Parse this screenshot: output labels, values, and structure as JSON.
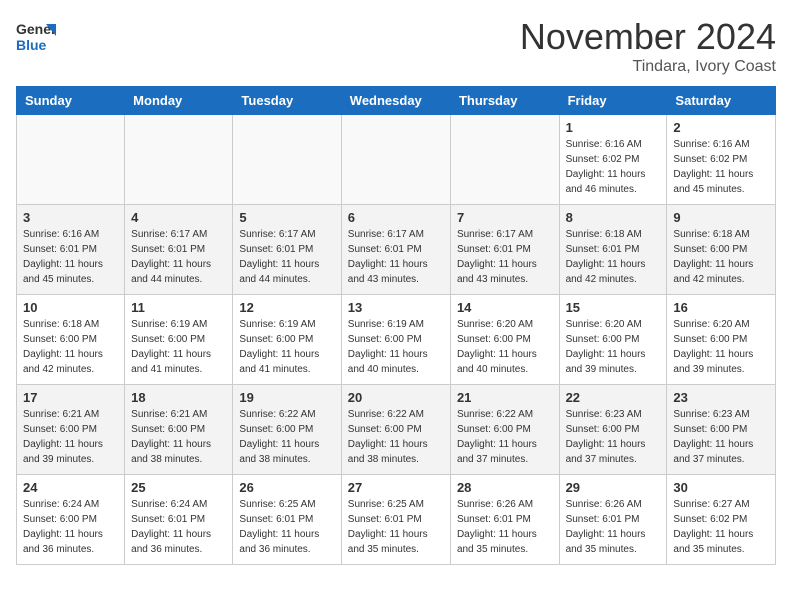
{
  "header": {
    "logo": {
      "text1": "General",
      "text2": "Blue"
    },
    "title": "November 2024",
    "location": "Tindara, Ivory Coast"
  },
  "calendar": {
    "days": [
      "Sunday",
      "Monday",
      "Tuesday",
      "Wednesday",
      "Thursday",
      "Friday",
      "Saturday"
    ],
    "weeks": [
      [
        {
          "day": "",
          "empty": true
        },
        {
          "day": "",
          "empty": true
        },
        {
          "day": "",
          "empty": true
        },
        {
          "day": "",
          "empty": true
        },
        {
          "day": "",
          "empty": true
        },
        {
          "day": "1",
          "sunrise": "6:16 AM",
          "sunset": "6:02 PM",
          "daylight": "11 hours and 46 minutes."
        },
        {
          "day": "2",
          "sunrise": "6:16 AM",
          "sunset": "6:02 PM",
          "daylight": "11 hours and 45 minutes."
        }
      ],
      [
        {
          "day": "3",
          "sunrise": "6:16 AM",
          "sunset": "6:01 PM",
          "daylight": "11 hours and 45 minutes."
        },
        {
          "day": "4",
          "sunrise": "6:17 AM",
          "sunset": "6:01 PM",
          "daylight": "11 hours and 44 minutes."
        },
        {
          "day": "5",
          "sunrise": "6:17 AM",
          "sunset": "6:01 PM",
          "daylight": "11 hours and 44 minutes."
        },
        {
          "day": "6",
          "sunrise": "6:17 AM",
          "sunset": "6:01 PM",
          "daylight": "11 hours and 43 minutes."
        },
        {
          "day": "7",
          "sunrise": "6:17 AM",
          "sunset": "6:01 PM",
          "daylight": "11 hours and 43 minutes."
        },
        {
          "day": "8",
          "sunrise": "6:18 AM",
          "sunset": "6:01 PM",
          "daylight": "11 hours and 42 minutes."
        },
        {
          "day": "9",
          "sunrise": "6:18 AM",
          "sunset": "6:00 PM",
          "daylight": "11 hours and 42 minutes."
        }
      ],
      [
        {
          "day": "10",
          "sunrise": "6:18 AM",
          "sunset": "6:00 PM",
          "daylight": "11 hours and 42 minutes."
        },
        {
          "day": "11",
          "sunrise": "6:19 AM",
          "sunset": "6:00 PM",
          "daylight": "11 hours and 41 minutes."
        },
        {
          "day": "12",
          "sunrise": "6:19 AM",
          "sunset": "6:00 PM",
          "daylight": "11 hours and 41 minutes."
        },
        {
          "day": "13",
          "sunrise": "6:19 AM",
          "sunset": "6:00 PM",
          "daylight": "11 hours and 40 minutes."
        },
        {
          "day": "14",
          "sunrise": "6:20 AM",
          "sunset": "6:00 PM",
          "daylight": "11 hours and 40 minutes."
        },
        {
          "day": "15",
          "sunrise": "6:20 AM",
          "sunset": "6:00 PM",
          "daylight": "11 hours and 39 minutes."
        },
        {
          "day": "16",
          "sunrise": "6:20 AM",
          "sunset": "6:00 PM",
          "daylight": "11 hours and 39 minutes."
        }
      ],
      [
        {
          "day": "17",
          "sunrise": "6:21 AM",
          "sunset": "6:00 PM",
          "daylight": "11 hours and 39 minutes."
        },
        {
          "day": "18",
          "sunrise": "6:21 AM",
          "sunset": "6:00 PM",
          "daylight": "11 hours and 38 minutes."
        },
        {
          "day": "19",
          "sunrise": "6:22 AM",
          "sunset": "6:00 PM",
          "daylight": "11 hours and 38 minutes."
        },
        {
          "day": "20",
          "sunrise": "6:22 AM",
          "sunset": "6:00 PM",
          "daylight": "11 hours and 38 minutes."
        },
        {
          "day": "21",
          "sunrise": "6:22 AM",
          "sunset": "6:00 PM",
          "daylight": "11 hours and 37 minutes."
        },
        {
          "day": "22",
          "sunrise": "6:23 AM",
          "sunset": "6:00 PM",
          "daylight": "11 hours and 37 minutes."
        },
        {
          "day": "23",
          "sunrise": "6:23 AM",
          "sunset": "6:00 PM",
          "daylight": "11 hours and 37 minutes."
        }
      ],
      [
        {
          "day": "24",
          "sunrise": "6:24 AM",
          "sunset": "6:00 PM",
          "daylight": "11 hours and 36 minutes."
        },
        {
          "day": "25",
          "sunrise": "6:24 AM",
          "sunset": "6:01 PM",
          "daylight": "11 hours and 36 minutes."
        },
        {
          "day": "26",
          "sunrise": "6:25 AM",
          "sunset": "6:01 PM",
          "daylight": "11 hours and 36 minutes."
        },
        {
          "day": "27",
          "sunrise": "6:25 AM",
          "sunset": "6:01 PM",
          "daylight": "11 hours and 35 minutes."
        },
        {
          "day": "28",
          "sunrise": "6:26 AM",
          "sunset": "6:01 PM",
          "daylight": "11 hours and 35 minutes."
        },
        {
          "day": "29",
          "sunrise": "6:26 AM",
          "sunset": "6:01 PM",
          "daylight": "11 hours and 35 minutes."
        },
        {
          "day": "30",
          "sunrise": "6:27 AM",
          "sunset": "6:02 PM",
          "daylight": "11 hours and 35 minutes."
        }
      ]
    ]
  }
}
